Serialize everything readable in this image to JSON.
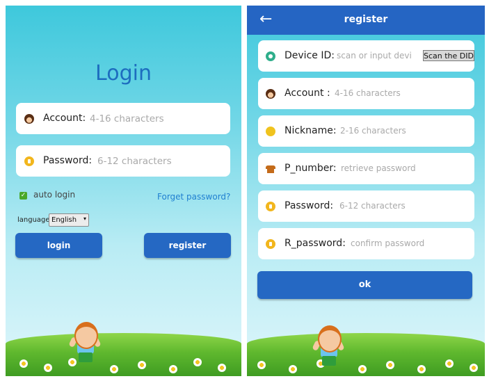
{
  "login": {
    "title": "Login",
    "account": {
      "label": "Account:",
      "placeholder": "4-16 characters"
    },
    "password": {
      "label": "Password:",
      "placeholder": "6-12 characters"
    },
    "auto_login": {
      "label": "auto login",
      "checked": true
    },
    "forget_password": "Forget password?",
    "language": {
      "label": "language:",
      "selected": "English"
    },
    "login_button": "login",
    "register_button": "register"
  },
  "register": {
    "back_icon": "arrow-left-icon",
    "title": "register",
    "device_id": {
      "label": "Device ID:",
      "placeholder": "scan or input devic",
      "scan_button": "Scan the DID"
    },
    "account": {
      "label": "Account :",
      "placeholder": "4-16 characters"
    },
    "nickname": {
      "label": "Nickname:",
      "placeholder": "2-16 characters"
    },
    "p_number": {
      "label": "P_number:",
      "placeholder": "retrieve password"
    },
    "password": {
      "label": "Password:",
      "placeholder": "6-12 characters"
    },
    "r_password": {
      "label": "R_password:",
      "placeholder": "confirm password"
    },
    "ok_button": "ok"
  },
  "colors": {
    "primary": "#2568c3",
    "link": "#1f7fd0",
    "title": "#1d6dbf",
    "sky_top": "#3ec8dc"
  }
}
